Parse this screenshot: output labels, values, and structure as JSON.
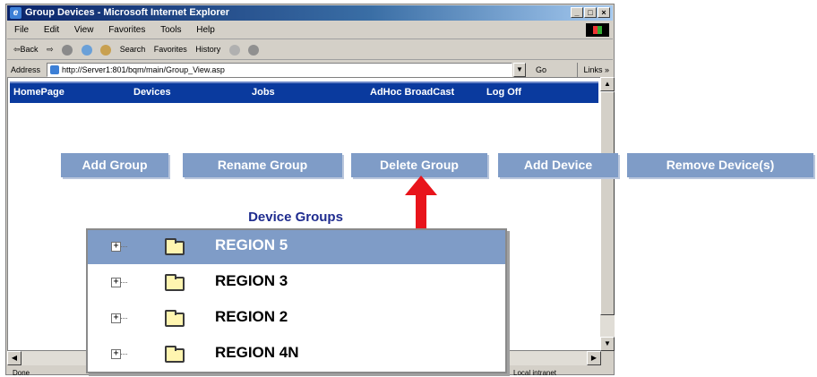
{
  "window": {
    "title": "Group Devices - Microsoft Internet Explorer",
    "controls": [
      "_",
      "□",
      "×"
    ]
  },
  "menu": [
    "File",
    "Edit",
    "View",
    "Favorites",
    "Tools",
    "Help"
  ],
  "toolbar": {
    "back": "⇦Back",
    "forward": "⇨",
    "search": "Search",
    "favorites": "Favorites",
    "history": "History"
  },
  "address": {
    "label": "Address",
    "url": "http://Server1:801/bqm/main/Group_View.asp",
    "go": "Go",
    "links": "Links »"
  },
  "nav": [
    "HomePage",
    "Devices",
    "Jobs",
    "AdHoc BroadCast",
    "Log Off"
  ],
  "actions": [
    "Add Group",
    "Rename Group",
    "Delete Group",
    "Add Device",
    "Remove Device(s)"
  ],
  "device_groups": {
    "title": "Device Groups",
    "items": [
      {
        "label": "REGION 5",
        "selected": true
      },
      {
        "label": "REGION 3",
        "selected": false
      },
      {
        "label": "REGION 2",
        "selected": false
      },
      {
        "label": "REGION 4N",
        "selected": false
      }
    ]
  },
  "status": {
    "left": "Done",
    "zone": "Local intranet"
  },
  "colors": {
    "nav_bar": "#0a3a9e",
    "button": "#7f9cc7",
    "arrow": "#e8141b",
    "group_title": "#1f2c8f"
  }
}
